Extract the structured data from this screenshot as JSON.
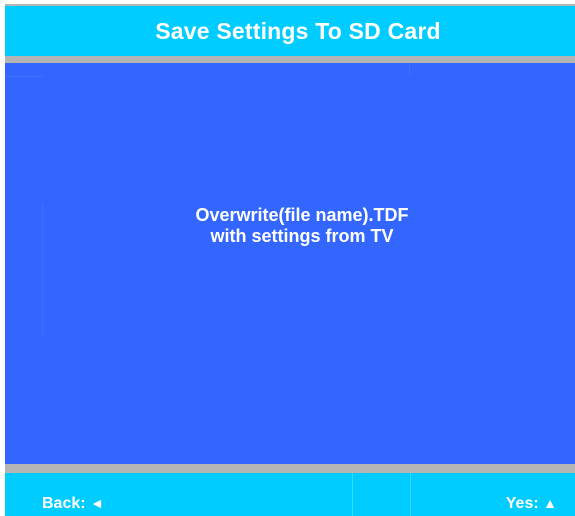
{
  "header": {
    "title": "Save Settings To SD Card"
  },
  "message": {
    "line1": "Overwrite(file name).TDF",
    "line2": "with settings from TV"
  },
  "footer": {
    "back_label": "Back:",
    "back_icon": "◄",
    "yes_label": "Yes:",
    "yes_icon": "▲"
  },
  "colors": {
    "title_bar": "#00ccff",
    "main_panel": "#3366ff",
    "divider": "#b4b4b4",
    "text": "#ffffff"
  }
}
